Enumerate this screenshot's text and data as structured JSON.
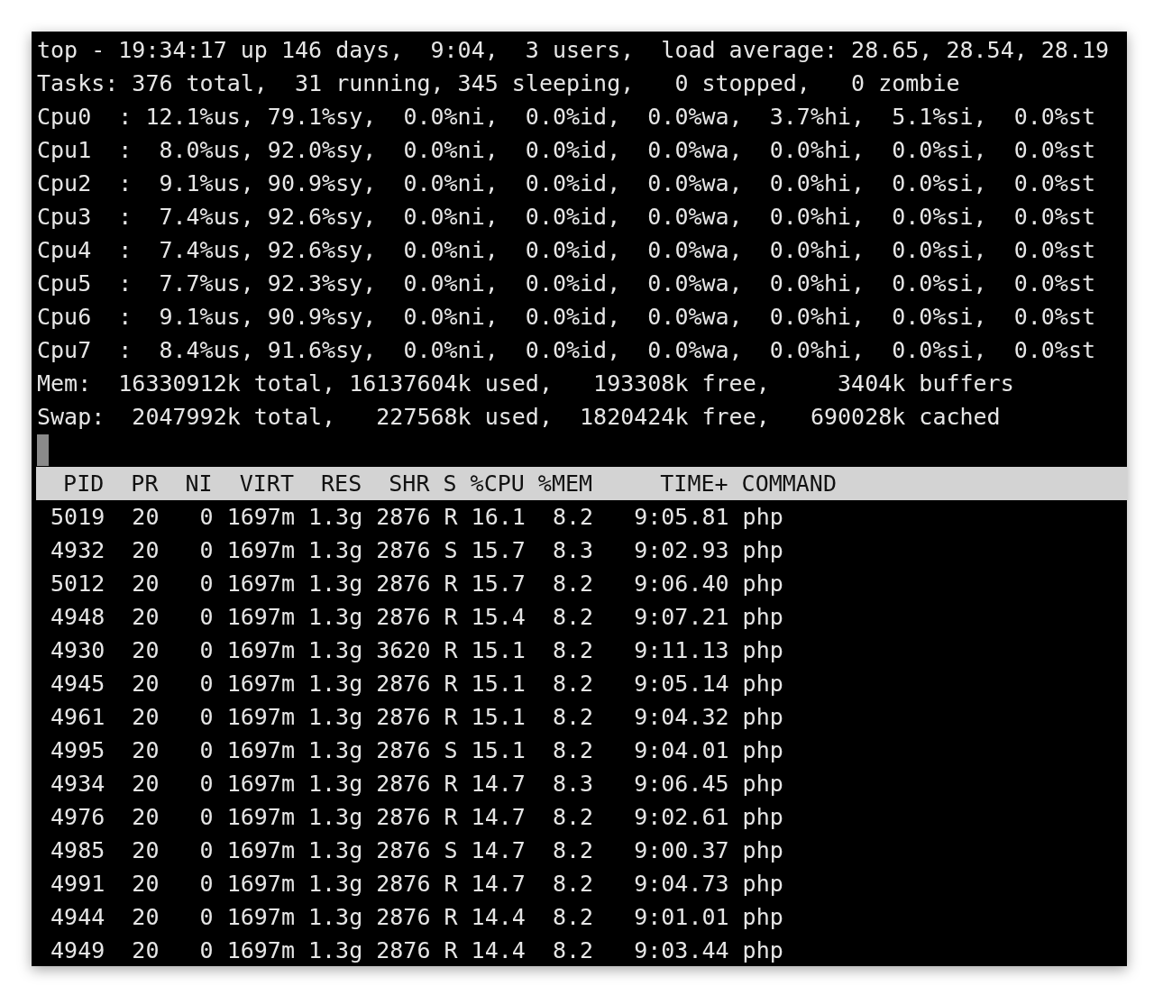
{
  "summary_lines": [
    "top - 19:34:17 up 146 days,  9:04,  3 users,  load average: 28.65, 28.54, 28.19",
    "Tasks: 376 total,  31 running, 345 sleeping,   0 stopped,   0 zombie",
    "Cpu0  : 12.1%us, 79.1%sy,  0.0%ni,  0.0%id,  0.0%wa,  3.7%hi,  5.1%si,  0.0%st",
    "Cpu1  :  8.0%us, 92.0%sy,  0.0%ni,  0.0%id,  0.0%wa,  0.0%hi,  0.0%si,  0.0%st",
    "Cpu2  :  9.1%us, 90.9%sy,  0.0%ni,  0.0%id,  0.0%wa,  0.0%hi,  0.0%si,  0.0%st",
    "Cpu3  :  7.4%us, 92.6%sy,  0.0%ni,  0.0%id,  0.0%wa,  0.0%hi,  0.0%si,  0.0%st",
    "Cpu4  :  7.4%us, 92.6%sy,  0.0%ni,  0.0%id,  0.0%wa,  0.0%hi,  0.0%si,  0.0%st",
    "Cpu5  :  7.7%us, 92.3%sy,  0.0%ni,  0.0%id,  0.0%wa,  0.0%hi,  0.0%si,  0.0%st",
    "Cpu6  :  9.1%us, 90.9%sy,  0.0%ni,  0.0%id,  0.0%wa,  0.0%hi,  0.0%si,  0.0%st",
    "Cpu7  :  8.4%us, 91.6%sy,  0.0%ni,  0.0%id,  0.0%wa,  0.0%hi,  0.0%si,  0.0%st",
    "Mem:  16330912k total, 16137604k used,   193308k free,     3404k buffers",
    "Swap:  2047992k total,   227568k used,  1820424k free,   690028k cached"
  ],
  "table": {
    "columns": [
      "PID",
      "PR",
      "NI",
      "VIRT",
      "RES",
      "SHR",
      "S",
      "%CPU",
      "%MEM",
      "TIME+",
      "COMMAND"
    ],
    "rows": [
      [
        "5019",
        "20",
        "0",
        "1697m",
        "1.3g",
        "2876",
        "R",
        "16.1",
        "8.2",
        "9:05.81",
        "php"
      ],
      [
        "4932",
        "20",
        "0",
        "1697m",
        "1.3g",
        "2876",
        "S",
        "15.7",
        "8.3",
        "9:02.93",
        "php"
      ],
      [
        "5012",
        "20",
        "0",
        "1697m",
        "1.3g",
        "2876",
        "R",
        "15.7",
        "8.2",
        "9:06.40",
        "php"
      ],
      [
        "4948",
        "20",
        "0",
        "1697m",
        "1.3g",
        "2876",
        "R",
        "15.4",
        "8.2",
        "9:07.21",
        "php"
      ],
      [
        "4930",
        "20",
        "0",
        "1697m",
        "1.3g",
        "3620",
        "R",
        "15.1",
        "8.2",
        "9:11.13",
        "php"
      ],
      [
        "4945",
        "20",
        "0",
        "1697m",
        "1.3g",
        "2876",
        "R",
        "15.1",
        "8.2",
        "9:05.14",
        "php"
      ],
      [
        "4961",
        "20",
        "0",
        "1697m",
        "1.3g",
        "2876",
        "R",
        "15.1",
        "8.2",
        "9:04.32",
        "php"
      ],
      [
        "4995",
        "20",
        "0",
        "1697m",
        "1.3g",
        "2876",
        "S",
        "15.1",
        "8.2",
        "9:04.01",
        "php"
      ],
      [
        "4934",
        "20",
        "0",
        "1697m",
        "1.3g",
        "2876",
        "R",
        "14.7",
        "8.3",
        "9:06.45",
        "php"
      ],
      [
        "4976",
        "20",
        "0",
        "1697m",
        "1.3g",
        "2876",
        "R",
        "14.7",
        "8.2",
        "9:02.61",
        "php"
      ],
      [
        "4985",
        "20",
        "0",
        "1697m",
        "1.3g",
        "2876",
        "S",
        "14.7",
        "8.2",
        "9:00.37",
        "php"
      ],
      [
        "4991",
        "20",
        "0",
        "1697m",
        "1.3g",
        "2876",
        "R",
        "14.7",
        "8.2",
        "9:04.73",
        "php"
      ],
      [
        "4944",
        "20",
        "0",
        "1697m",
        "1.3g",
        "2876",
        "R",
        "14.4",
        "8.2",
        "9:01.01",
        "php"
      ],
      [
        "4949",
        "20",
        "0",
        "1697m",
        "1.3g",
        "2876",
        "R",
        "14.4",
        "8.2",
        "9:03.44",
        "php"
      ]
    ]
  }
}
